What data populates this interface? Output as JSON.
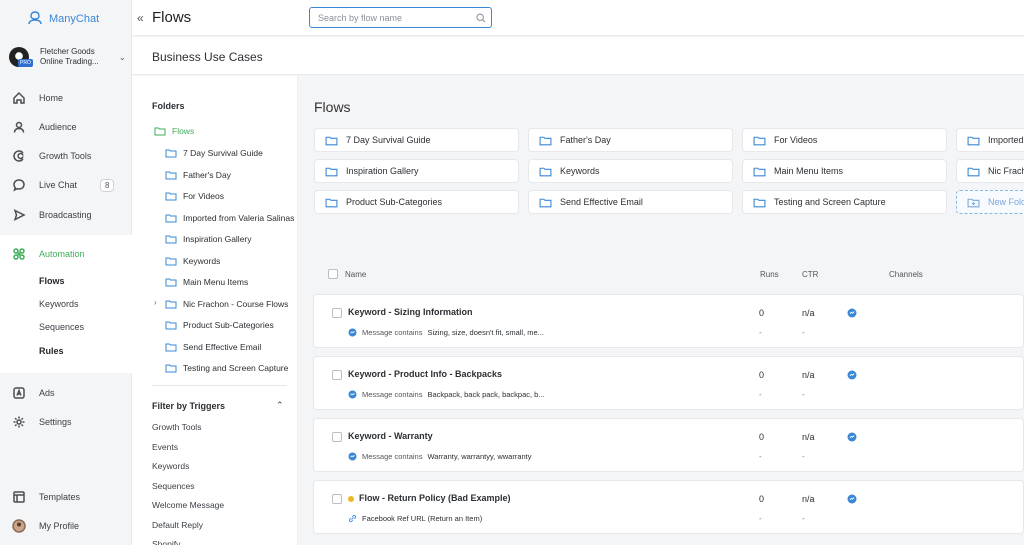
{
  "app": {
    "brand": "ManyChat"
  },
  "account": {
    "name": "Fletcher Goods Online Trading...",
    "badge": "PRO"
  },
  "nav": {
    "home": "Home",
    "audience": "Audience",
    "growth_tools": "Growth Tools",
    "live_chat": "Live Chat",
    "live_chat_count": "8",
    "broadcasting": "Broadcasting",
    "automation": "Automation",
    "sub": {
      "flows": "Flows",
      "keywords": "Keywords",
      "sequences": "Sequences",
      "rules": "Rules"
    },
    "ads": "Ads",
    "settings": "Settings",
    "templates": "Templates",
    "my_profile": "My Profile"
  },
  "topbar": {
    "title": "Flows",
    "search_placeholder": "Search by flow name"
  },
  "header": {
    "title": "Business Use Cases"
  },
  "folders": {
    "heading": "Folders",
    "root": "Flows",
    "items": [
      "7 Day Survival Guide",
      "Father's Day",
      "For Videos",
      "Imported from Valeria Salinas",
      "Inspiration Gallery",
      "Keywords",
      "Main Menu Items",
      "Nic Frachon - Course Flows",
      "Product Sub-Categories",
      "Send Effective Email",
      "Testing and Screen Capture"
    ]
  },
  "filters": {
    "heading": "Filter by Triggers",
    "items": [
      "Growth Tools",
      "Events",
      "Keywords",
      "Sequences",
      "Welcome Message",
      "Default Reply",
      "Shopify"
    ]
  },
  "main": {
    "title": "Flows",
    "folder_cards": [
      "7 Day Survival Guide",
      "Father's Day",
      "For Videos",
      "Imported from Valeria Salinas",
      "Inspiration Gallery",
      "Keywords",
      "Main Menu Items",
      "Nic Frachon - Course Flows",
      "Product Sub-Categories",
      "Send Effective Email",
      "Testing and Screen Capture",
      "New Folder"
    ],
    "columns": {
      "name": "Name",
      "runs": "Runs",
      "ctr": "CTR",
      "channels": "Channels"
    },
    "rows": [
      {
        "title": "Keyword - Sizing Information",
        "prefix": "Message contains",
        "trigger": "Sizing, size, doesn't fit, small, me...",
        "runs": "0",
        "ctr": "n/a",
        "runs2": "-",
        "ctr2": "-"
      },
      {
        "title": "Keyword - Product Info - Backpacks",
        "prefix": "Message contains",
        "trigger": "Backpack, back pack, backpac, b...",
        "runs": "0",
        "ctr": "n/a",
        "runs2": "-",
        "ctr2": "-"
      },
      {
        "title": "Keyword - Warranty",
        "prefix": "Message contains",
        "trigger": "Warranty, warrantyy, wwarranty",
        "runs": "0",
        "ctr": "n/a",
        "runs2": "-",
        "ctr2": "-"
      },
      {
        "title": "Flow - Return Policy (Bad Example)",
        "prefix": "",
        "trigger": "Facebook Ref URL (Return an Item)",
        "runs": "0",
        "ctr": "n/a",
        "runs2": "-",
        "ctr2": "-"
      }
    ]
  },
  "colors": {
    "accent_blue": "#3a87d6",
    "accent_green": "#3fae5a",
    "draft_dot": "#f0b429"
  },
  "icons": {
    "brand": "manychat-logo-icon",
    "home": "home-icon",
    "audience": "user-icon",
    "growth": "magnet-icon",
    "chat": "chat-bubble-icon",
    "broadcast": "send-icon",
    "automation": "automation-icon",
    "ads": "ads-icon",
    "settings": "gear-icon",
    "templates": "template-icon",
    "folder": "folder-icon",
    "messenger": "messenger-icon",
    "link": "link-icon",
    "search": "search-icon"
  }
}
